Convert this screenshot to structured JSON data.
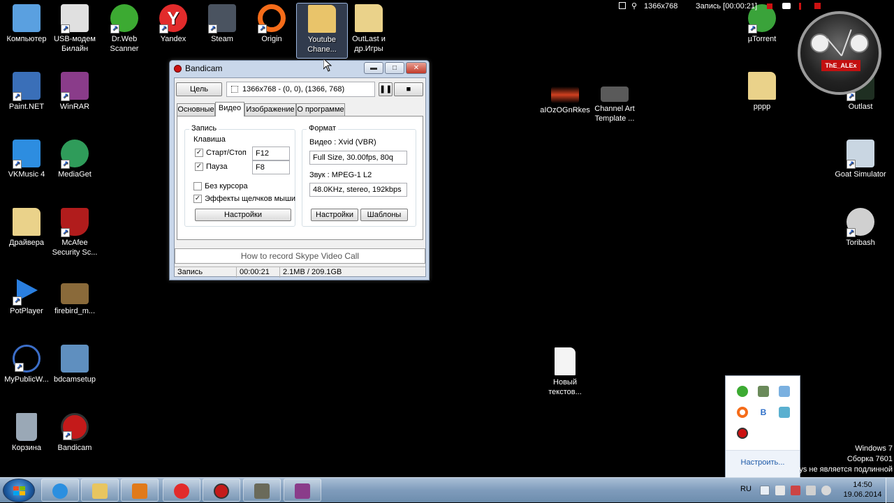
{
  "desktop": {
    "icons": [
      {
        "label": "Компьютер",
        "icon": "computer-icon",
        "color": "#5aa0e0"
      },
      {
        "label": "USB-модем Билайн",
        "icon": "usb-modem-icon",
        "color": "#e0e0e0"
      },
      {
        "label": "Dr.Web Scanner",
        "icon": "drweb-icon",
        "color": "#3caa32"
      },
      {
        "label": "Yandex",
        "icon": "yandex-icon",
        "color": "#e22b2b"
      },
      {
        "label": "Steam",
        "icon": "steam-icon",
        "color": "#4a5360"
      },
      {
        "label": "Origin",
        "icon": "origin-icon",
        "color": "#f56c19"
      },
      {
        "label": "Youtube Chane...",
        "icon": "folder-icon",
        "color": "#e9c46a"
      },
      {
        "label": "OutLast и др.Игры",
        "icon": "folder-icon",
        "color": "#ead28a"
      },
      {
        "label": "Paint.NET",
        "icon": "paintnet-icon",
        "color": "#3a6fb8"
      },
      {
        "label": "WinRAR",
        "icon": "winrar-icon",
        "color": "#8a3c8a"
      },
      {
        "label": "VKMusic 4",
        "icon": "vkmusic-icon",
        "color": "#2d8de0"
      },
      {
        "label": "MediaGet",
        "icon": "mediaget-icon",
        "color": "#2f9c5a"
      },
      {
        "label": "Драйвера",
        "icon": "folder-icon",
        "color": "#ead28a"
      },
      {
        "label": "McAfee Security Sc...",
        "icon": "mcafee-icon",
        "color": "#b11c1c"
      },
      {
        "label": "PotPlayer",
        "icon": "potplayer-icon",
        "color": "#2a7fe0"
      },
      {
        "label": "firebird_m...",
        "icon": "tank-game-icon",
        "color": "#8a6a3a"
      },
      {
        "label": "MyPublicW...",
        "icon": "wifi-hotspot-icon",
        "color": "#3c6ec8"
      },
      {
        "label": "bdcamsetup",
        "icon": "installer-icon",
        "color": "#5f8fbf"
      },
      {
        "label": "Корзина",
        "icon": "recycle-bin-icon",
        "color": "#9aa8b6"
      },
      {
        "label": "Bandicam",
        "icon": "bandicam-icon",
        "color": "#c41a1a"
      },
      {
        "label": "aIOzOGnRkes",
        "icon": "audio-wave-icon",
        "color": "#d04020"
      },
      {
        "label": "Channel Art Template ...",
        "icon": "image-file-icon",
        "color": "#5a5a5a"
      },
      {
        "label": "µTorrent",
        "icon": "utorrent-icon",
        "color": "#3aa33a"
      },
      {
        "label": "pppp",
        "icon": "folder-icon",
        "color": "#ead28a"
      },
      {
        "label": "Outlast",
        "icon": "outlast-icon",
        "color": "#1f2f22"
      },
      {
        "label": "Goat Simulator",
        "icon": "goat-simulator-icon",
        "color": "#c9d6e2"
      },
      {
        "label": "Toribash",
        "icon": "toribash-icon",
        "color": "#d0d0d0"
      },
      {
        "label": "Новый текстов...",
        "icon": "text-file-icon",
        "color": "#f4f4f4"
      }
    ]
  },
  "overlay": {
    "resolution": "1366x768",
    "recording": "Запись [00:00:21]"
  },
  "clock": {
    "brand": "ThE_ALEx"
  },
  "bandicam": {
    "title": "Bandicam",
    "target_button": "Цель",
    "target_info": "1366x768 - (0, 0), (1366, 768)",
    "tabs": [
      "Основные",
      "Видео",
      "Изображение",
      "О программе"
    ],
    "active_tab": "Видео",
    "record_group": {
      "title": "Запись",
      "hotkey_label": "Клавиша",
      "start_stop_label": "Старт/Стоп",
      "start_stop_key": "F12",
      "pause_label": "Пауза",
      "pause_key": "F8",
      "hide_cursor_label": "Без курсора",
      "click_effects_label": "Эффекты щелчков мыши",
      "settings_button": "Настройки"
    },
    "format_group": {
      "title": "Формат",
      "video_label": "Видео : Xvid (VBR)",
      "video_value": "Full Size, 30.00fps, 80q",
      "audio_label": "Звук : MPEG-1 L2",
      "audio_value": "48.0KHz, stereo, 192kbps",
      "settings_button": "Настройки",
      "presets_button": "Шаблоны"
    },
    "link": "How to record Skype Video Call",
    "status": {
      "state": "Запись",
      "time": "00:00:21",
      "size": "2.1MB / 209.1GB"
    }
  },
  "tray_popup": {
    "customize": "Настроить..."
  },
  "windows_info": {
    "line1": "Windows 7",
    "line2": "Сборка 7601",
    "line3": "ys не является подлинной"
  },
  "taskbar": {
    "language": "RU",
    "time": "14:50",
    "date": "19.06.2014",
    "apps": [
      {
        "name": "internet-explorer-icon",
        "color": "#2b8fe0"
      },
      {
        "name": "explorer-folder-icon",
        "color": "#e8c560"
      },
      {
        "name": "media-player-icon",
        "color": "#e07a1a"
      },
      {
        "name": "yandex-icon",
        "color": "#e22b2b"
      },
      {
        "name": "bandicam-icon",
        "color": "#c41a1a"
      },
      {
        "name": "tank-game-icon",
        "color": "#6a6a5a"
      },
      {
        "name": "winrar-icon",
        "color": "#8a3c8a"
      }
    ]
  }
}
